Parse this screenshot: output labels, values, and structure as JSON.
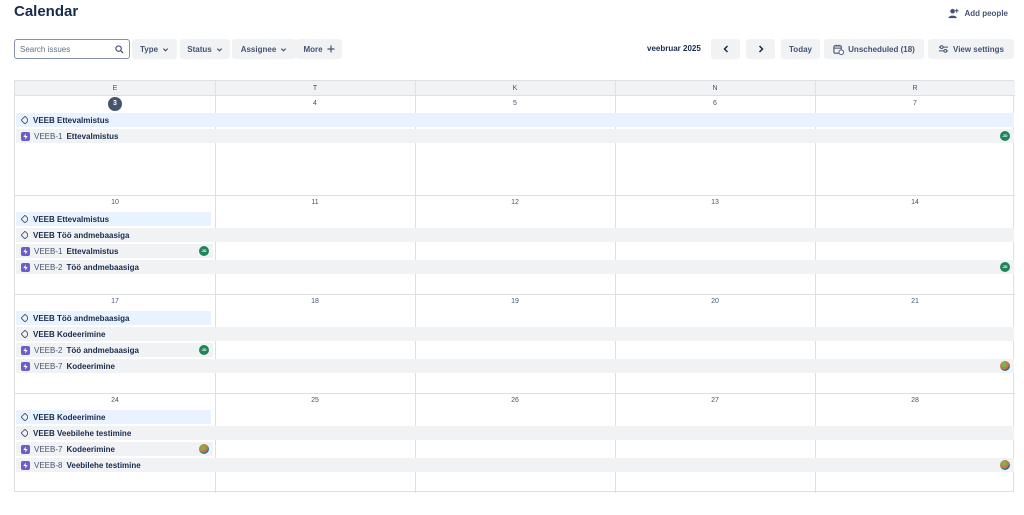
{
  "page": {
    "title": "Calendar",
    "add_people": "Add people"
  },
  "toolbar": {
    "search_placeholder": "Search issues",
    "type": "Type",
    "status": "Status",
    "assignee": "Assignee",
    "more": "More",
    "month": "veebruar 2025",
    "today": "Today",
    "unscheduled": "Unscheduled (18)",
    "view_settings": "View settings"
  },
  "weekdays": [
    "E",
    "T",
    "K",
    "N",
    "R"
  ],
  "weeks": [
    {
      "days": [
        "3",
        "4",
        "5",
        "6",
        "7"
      ],
      "today_index": 0,
      "bars": [
        {
          "kind": "version",
          "label": "VEEB Ettevalmistus"
        },
        {
          "kind": "issue",
          "key": "VEEB-1",
          "label": "Ettevalmistus",
          "avatar": "JD"
        }
      ]
    },
    {
      "days": [
        "10",
        "11",
        "12",
        "13",
        "14"
      ],
      "bars": [
        {
          "kind": "version",
          "label": "VEEB Ettevalmistus"
        },
        {
          "kind": "version",
          "label": "VEEB Töö andmebaasiga"
        },
        {
          "kind": "issue",
          "key": "VEEB-1",
          "label": "Ettevalmistus",
          "avatar": "JD"
        },
        {
          "kind": "issue",
          "key": "VEEB-2",
          "label": "Töö andmebaasiga",
          "avatar": "JD"
        }
      ]
    },
    {
      "days": [
        "17",
        "18",
        "19",
        "20",
        "21"
      ],
      "bars": [
        {
          "kind": "version",
          "label": "VEEB Töö andmebaasiga"
        },
        {
          "kind": "version",
          "label": "VEEB Kodeerimine"
        },
        {
          "kind": "issue",
          "key": "VEEB-2",
          "label": "Töö andmebaasiga",
          "avatar": "JD"
        },
        {
          "kind": "issue",
          "key": "VEEB-7",
          "label": "Kodeerimine",
          "avatar": "photo"
        }
      ]
    },
    {
      "days": [
        "24",
        "25",
        "26",
        "27",
        "28"
      ],
      "bars": [
        {
          "kind": "version",
          "label": "VEEB Kodeerimine"
        },
        {
          "kind": "version",
          "label": "VEEB Veebilehe testimine"
        },
        {
          "kind": "issue",
          "key": "VEEB-7",
          "label": "Kodeerimine",
          "avatar": "photo"
        },
        {
          "kind": "issue",
          "key": "VEEB-8",
          "label": "Veebilehe testimine",
          "avatar": "photo"
        }
      ]
    }
  ],
  "colors": {
    "version_bar": "#e9f2ff",
    "issue_bar": "#f1f2f4",
    "epic_icon": "#6e5dc6",
    "avatar_green": "#1f845a"
  }
}
